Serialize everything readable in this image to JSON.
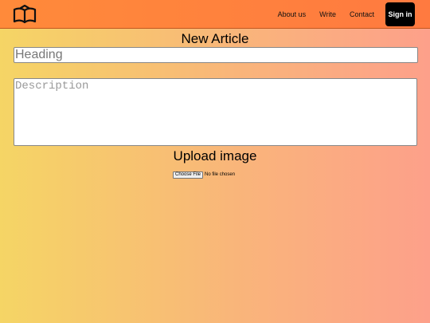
{
  "navbar": {
    "logo_icon": "open-book-icon",
    "links": {
      "about": "About us",
      "write": "Write",
      "contact": "Contact"
    },
    "signin_label": "Sign in"
  },
  "form": {
    "title": "New Article",
    "heading_placeholder": "Heading",
    "heading_value": "",
    "description_placeholder": "Description",
    "description_value": "",
    "upload_title": "Upload image",
    "choose_file_label": "Choose File",
    "file_status": "No file chosen"
  },
  "colors": {
    "navbar": "#ff8a3a",
    "background_left": "#f5d565",
    "background_right": "#fda08a",
    "signin_bg": "#000000"
  }
}
